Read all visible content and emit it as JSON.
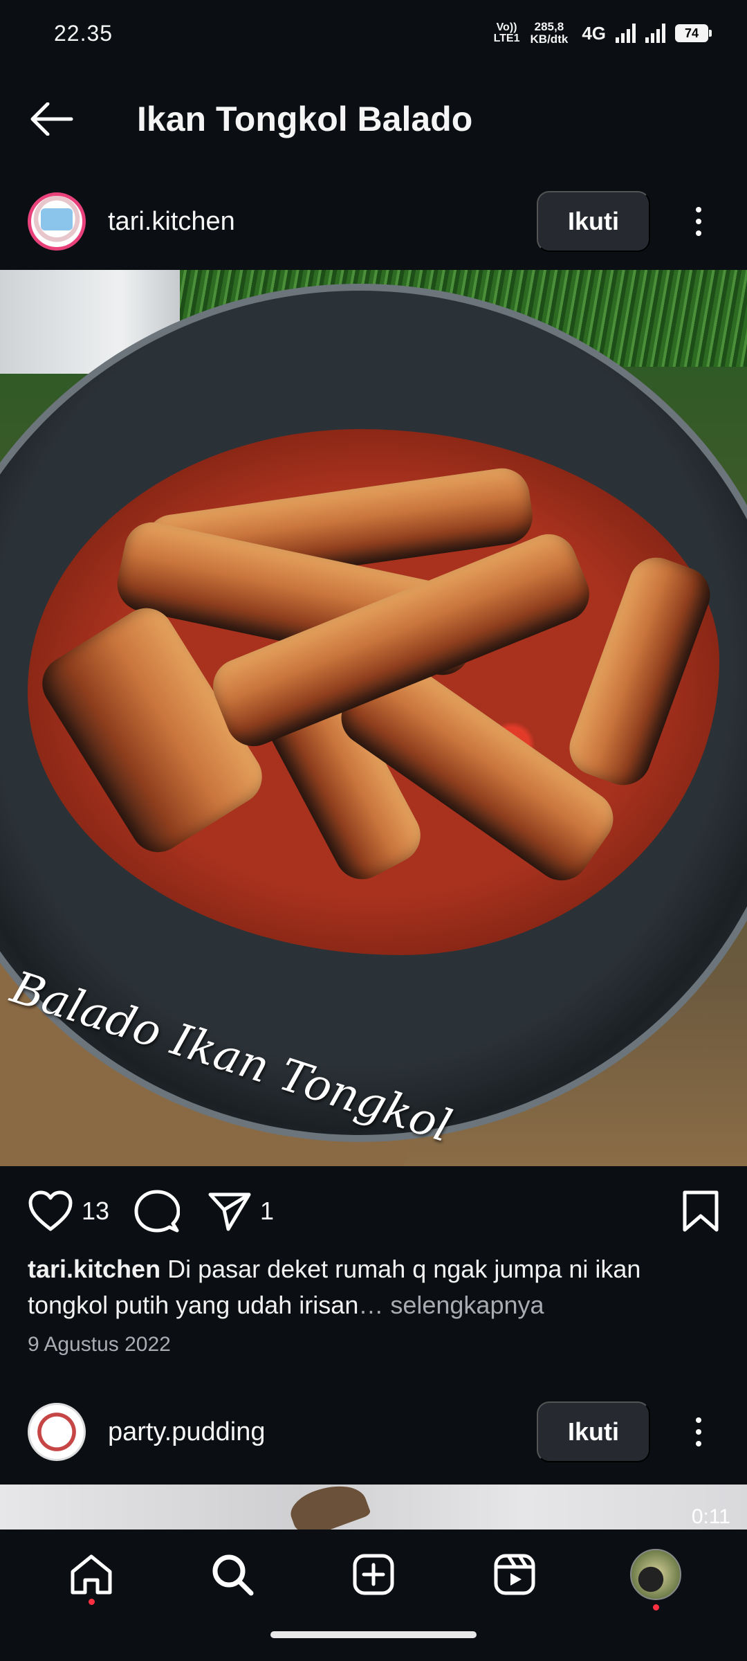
{
  "status_bar": {
    "time": "22.35",
    "volte": "Vo)) LTE1",
    "speed_value": "285,8",
    "speed_unit": "KB/dtk",
    "network": "4G",
    "battery": "74"
  },
  "header": {
    "title": "Ikan Tongkol Balado",
    "back_icon": "arrow-left-icon"
  },
  "post": {
    "username": "tari.kitchen",
    "follow_label": "Ikuti",
    "image_caption_text": "Balado Ikan Tongkol",
    "likes_count": "13",
    "shares_count": "1",
    "caption_user": "tari.kitchen",
    "caption_text": " Di pasar deket rumah q ngak jumpa ni ikan tongkol putih yang udah irisan",
    "caption_more": "… selengkapnya",
    "date": "9 Agustus 2022"
  },
  "next_post": {
    "username": "party.pudding",
    "follow_label": "Ikuti",
    "duration": "0:11"
  },
  "bottom_nav": {
    "items": [
      "home-icon",
      "search-icon",
      "create-icon",
      "reels-icon",
      "profile-avatar"
    ]
  },
  "colors": {
    "background": "#0b0f14",
    "button_bg": "#262a30",
    "notification_dot": "#ff3040",
    "avatar_ring": "#e9427b"
  }
}
